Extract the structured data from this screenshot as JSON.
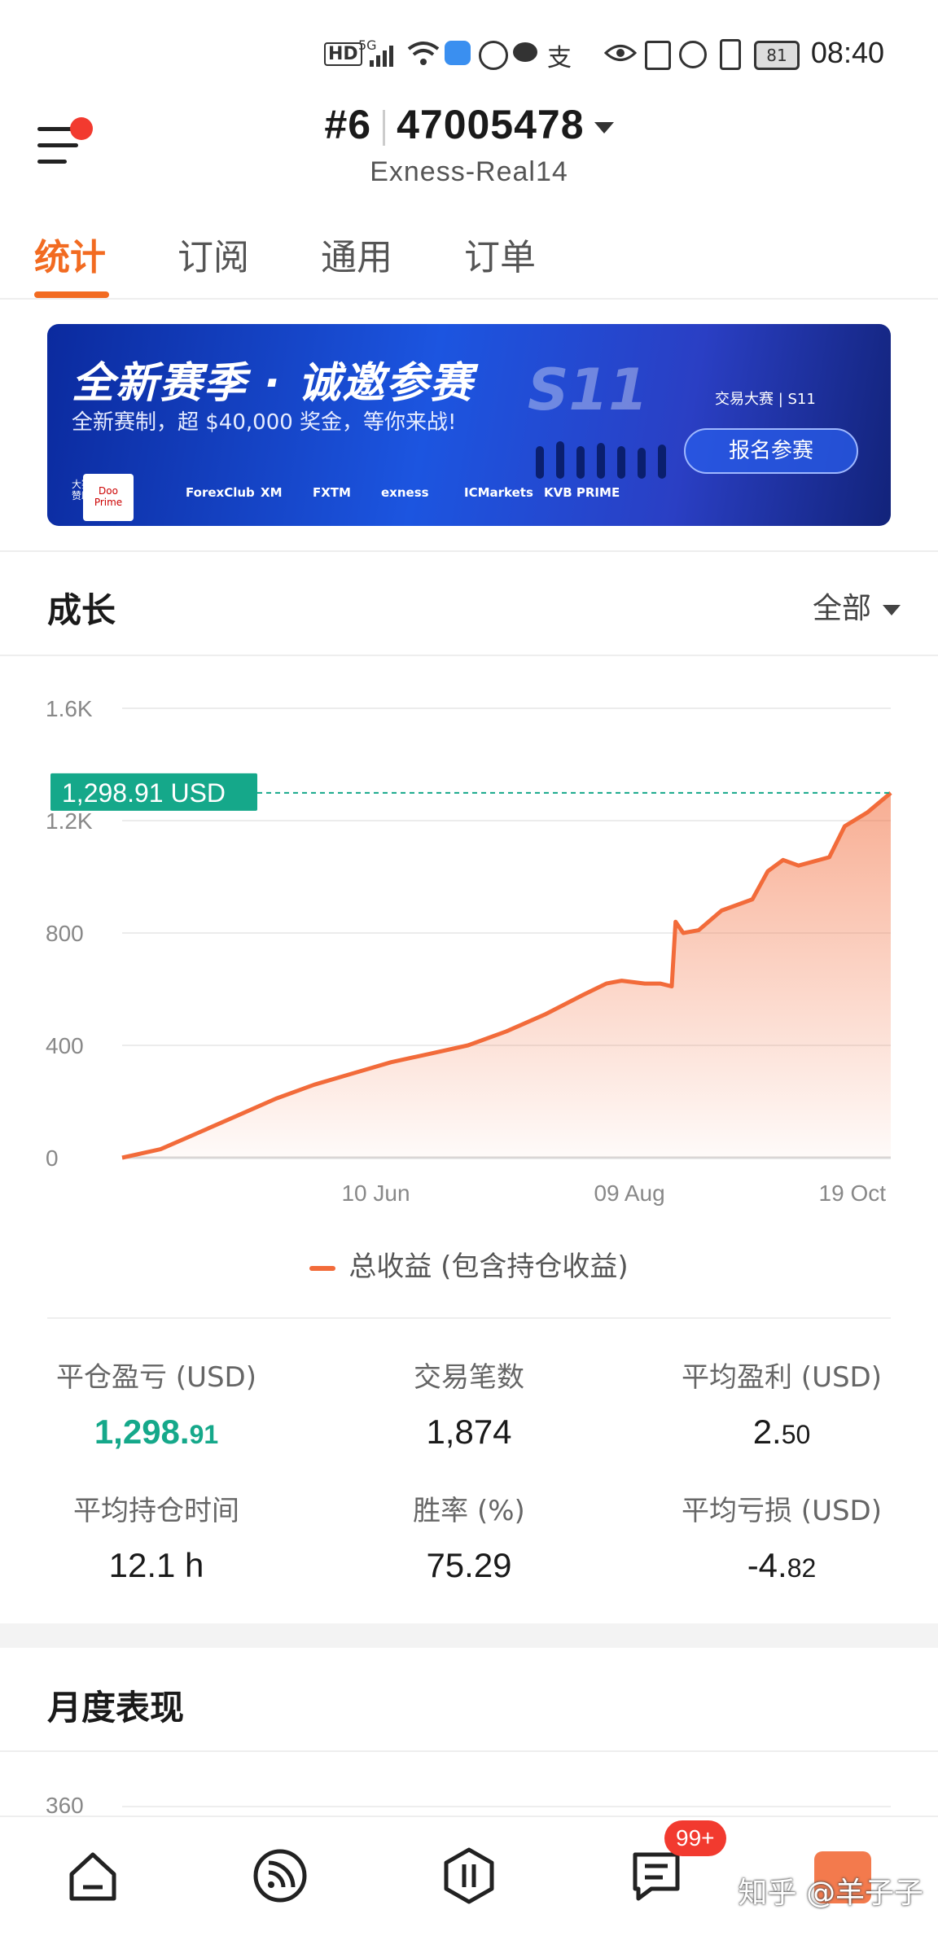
{
  "status_bar": {
    "time": "08:40",
    "battery": "81",
    "network_label": "HD",
    "signal_label": "5G"
  },
  "header": {
    "rank": "#6",
    "account_number": "47005478",
    "server": "Exness-Real14"
  },
  "tabs": [
    {
      "label": "统计",
      "active": true
    },
    {
      "label": "订阅",
      "active": false
    },
    {
      "label": "通用",
      "active": false
    },
    {
      "label": "订单",
      "active": false
    }
  ],
  "banner": {
    "title": "全新赛季 · 诚邀参赛",
    "subtitle": "全新赛制，超 $40,000 奖金，等你来战!",
    "season": "S11",
    "brand": "交易大赛 | S11",
    "cta": "报名参赛",
    "sponsor_label": "大赛赞助",
    "sponsors": [
      "Doo Prime",
      "ForexClub",
      "XM",
      "FXTM",
      "exness",
      "ICMarkets",
      "KVB PRIME"
    ]
  },
  "growth": {
    "title": "成长",
    "range": "全部",
    "current_value_label": "1,298.91 USD",
    "legend": "总收益 (包含持仓收益)"
  },
  "chart_data": {
    "type": "area",
    "title": "",
    "xlabel": "",
    "ylabel": "",
    "ylim": [
      0,
      1600
    ],
    "yticks": [
      "0",
      "400",
      "800",
      "1.2K",
      "1.6K"
    ],
    "xticks": [
      "10 Jun",
      "09 Aug",
      "19 Oct"
    ],
    "grid": true,
    "series": [
      {
        "name": "总收益 (包含持仓收益)",
        "color": "#f26b3a",
        "points": [
          [
            0,
            0
          ],
          [
            0.05,
            30
          ],
          [
            0.1,
            90
          ],
          [
            0.15,
            150
          ],
          [
            0.2,
            210
          ],
          [
            0.25,
            260
          ],
          [
            0.3,
            300
          ],
          [
            0.35,
            340
          ],
          [
            0.4,
            370
          ],
          [
            0.45,
            400
          ],
          [
            0.5,
            450
          ],
          [
            0.55,
            510
          ],
          [
            0.6,
            580
          ],
          [
            0.63,
            620
          ],
          [
            0.65,
            630
          ],
          [
            0.68,
            620
          ],
          [
            0.7,
            620
          ],
          [
            0.715,
            610
          ],
          [
            0.72,
            840
          ],
          [
            0.73,
            800
          ],
          [
            0.75,
            810
          ],
          [
            0.78,
            880
          ],
          [
            0.82,
            920
          ],
          [
            0.84,
            1020
          ],
          [
            0.86,
            1060
          ],
          [
            0.88,
            1040
          ],
          [
            0.92,
            1070
          ],
          [
            0.94,
            1180
          ],
          [
            0.97,
            1230
          ],
          [
            1.0,
            1298.91
          ]
        ]
      }
    ],
    "current_value": 1298.91
  },
  "stats": [
    {
      "label": "平仓盈亏 (USD)",
      "value_main": "1,298.",
      "value_small": "91",
      "green": true
    },
    {
      "label": "交易笔数",
      "value_main": "1,874",
      "value_small": "",
      "green": false
    },
    {
      "label": "平均盈利 (USD)",
      "value_main": "2.",
      "value_small": "50",
      "green": false
    },
    {
      "label": "平均持仓时间",
      "value_main": "12.1 h",
      "value_small": "",
      "green": false
    },
    {
      "label": "胜率 (%)",
      "value_main": "75.29",
      "value_small": "",
      "green": false
    },
    {
      "label": "平均亏损 (USD)",
      "value_main": "-4.",
      "value_small": "82",
      "green": false
    }
  ],
  "monthly": {
    "title": "月度表现",
    "first_tick": "360"
  },
  "bottom_nav": {
    "items": [
      "home-icon",
      "feed-icon",
      "trade-icon",
      "messages-icon",
      "profile-icon"
    ],
    "badge": "99+"
  },
  "watermark": "知乎 @羊子子",
  "colors": {
    "accent": "#f26b21",
    "green": "#15a88a",
    "line": "#f26b3a"
  }
}
